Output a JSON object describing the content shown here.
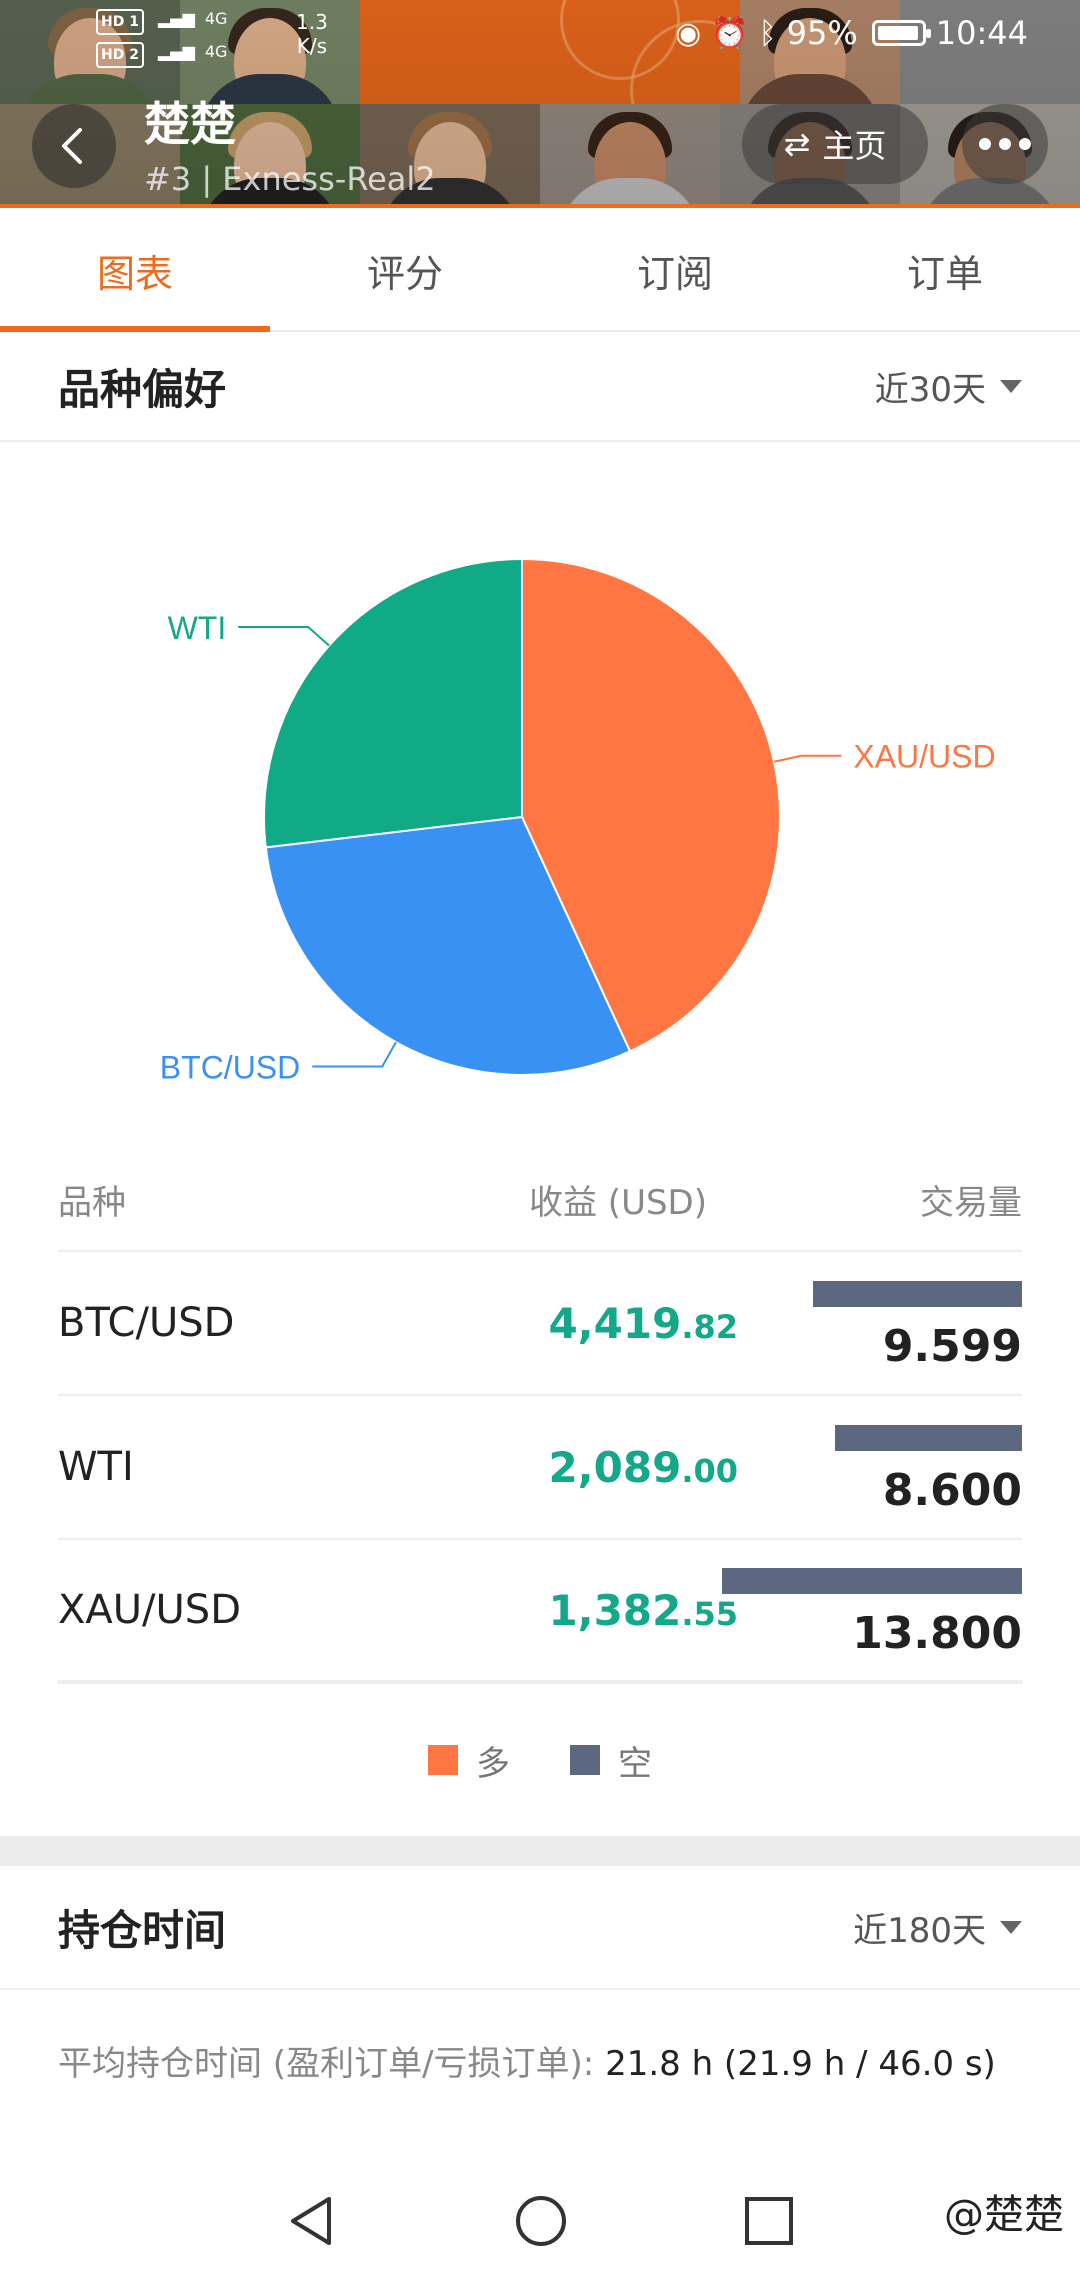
{
  "status_bar": {
    "hd1": "HD 1",
    "hd2": "HD 2",
    "network1": "4G",
    "network2": "4G",
    "speed": "1.3",
    "speed_unit": "K/s",
    "battery": "95%",
    "time": "10:44"
  },
  "profile": {
    "name": "楚楚",
    "subtitle": "#3 | Exness-Real2",
    "home_label": "主页"
  },
  "tabs": [
    {
      "label": "图表",
      "active": true
    },
    {
      "label": "评分",
      "active": false
    },
    {
      "label": "订阅",
      "active": false
    },
    {
      "label": "订单",
      "active": false
    }
  ],
  "symbol_pref": {
    "title": "品种偏好",
    "range": "近30天"
  },
  "chart_data": {
    "type": "pie",
    "slices": [
      {
        "label": "XAU/USD",
        "value": 13.8,
        "color": "#ff7643"
      },
      {
        "label": "BTC/USD",
        "value": 9.599,
        "color": "#3a91f4"
      },
      {
        "label": "WTI",
        "value": 8.6,
        "color": "#10aa87"
      }
    ]
  },
  "table": {
    "headers": {
      "name": "品种",
      "profit": "收益 (USD)",
      "volume": "交易量"
    },
    "rows": [
      {
        "name": "BTC/USD",
        "profit_int": "4,419",
        "profit_dec": ".82",
        "volume": "9.599",
        "volume_value": 9.599
      },
      {
        "name": "WTI",
        "profit_int": "2,089",
        "profit_dec": ".00",
        "volume": "8.600",
        "volume_value": 8.6
      },
      {
        "name": "XAU/USD",
        "profit_int": "1,382",
        "profit_dec": ".55",
        "volume": "13.800",
        "volume_value": 13.8
      }
    ]
  },
  "legend": {
    "long_label": "多",
    "short_label": "空",
    "long_color": "#ff7643",
    "short_color": "#5b6880"
  },
  "hold_time": {
    "title": "持仓时间",
    "range": "近180天",
    "avg_label": "平均持仓时间 (盈利订单/亏损订单): ",
    "avg_value": "21.8 h (21.9 h / 46.0 s)"
  },
  "watermark": "@楚楚"
}
